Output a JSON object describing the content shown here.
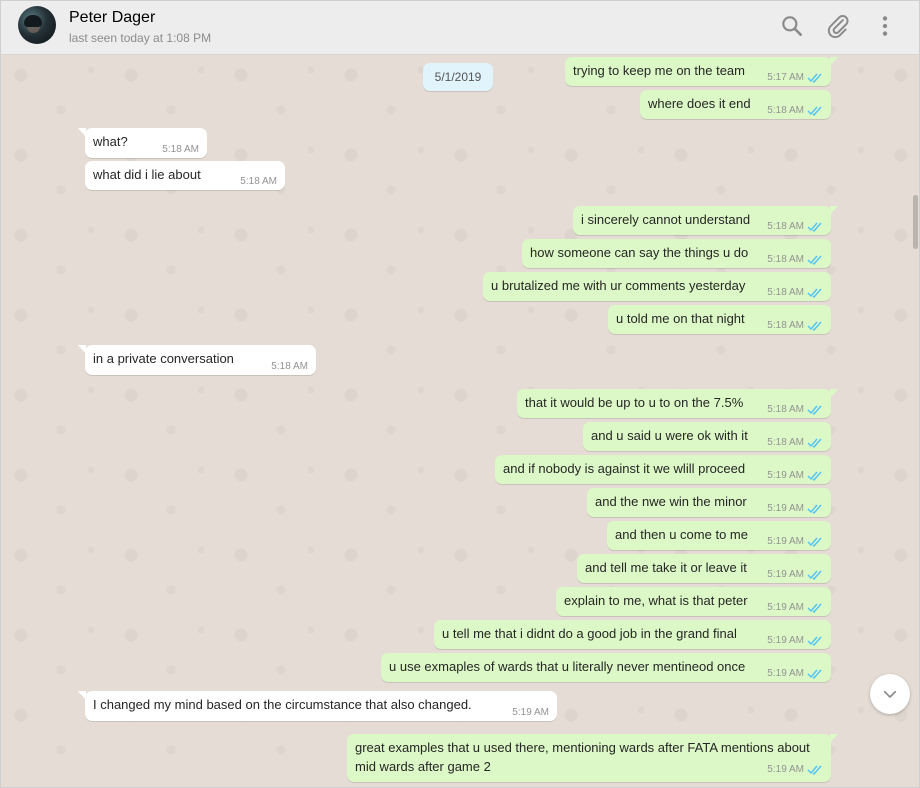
{
  "header": {
    "contact_name": "Peter Dager",
    "last_seen": "last seen today at 1:08 PM",
    "icons": [
      "search-icon",
      "attach-icon",
      "menu-icon"
    ]
  },
  "chat": {
    "date": "5/1/2019",
    "messages": [
      {
        "dir": "out",
        "text": "trying to keep me on the team",
        "time": "5:17 AM"
      },
      {
        "dir": "out",
        "text": "where does it end",
        "time": "5:18 AM"
      },
      {
        "dir": "in",
        "text": "what?",
        "time": "5:18 AM"
      },
      {
        "dir": "in",
        "text": "what did i lie about",
        "time": "5:18 AM"
      },
      {
        "dir": "out",
        "text": "i sincerely cannot understand",
        "time": "5:18 AM"
      },
      {
        "dir": "out",
        "text": "how someone can say the things u do",
        "time": "5:18 AM"
      },
      {
        "dir": "out",
        "text": "u brutalized me with ur comments yesterday",
        "time": "5:18 AM"
      },
      {
        "dir": "out",
        "text": "u told me on that night",
        "time": "5:18 AM"
      },
      {
        "dir": "in",
        "text": "in a private conversation",
        "time": "5:18 AM"
      },
      {
        "dir": "out",
        "text": "that it would be up to u to on the 7.5%",
        "time": "5:18 AM"
      },
      {
        "dir": "out",
        "text": "and u said u were ok with it",
        "time": "5:18 AM"
      },
      {
        "dir": "out",
        "text": "and if nobody is against it we wlill proceed",
        "time": "5:19 AM"
      },
      {
        "dir": "out",
        "text": "and the nwe win the minor",
        "time": "5:19 AM"
      },
      {
        "dir": "out",
        "text": "and then u come to me",
        "time": "5:19 AM"
      },
      {
        "dir": "out",
        "text": "and tell me take it or leave it",
        "time": "5:19 AM"
      },
      {
        "dir": "out",
        "text": "explain to me, what is that peter",
        "time": "5:19 AM"
      },
      {
        "dir": "out",
        "text": "u tell me that i didnt do a good job in the grand final",
        "time": "5:19 AM"
      },
      {
        "dir": "out",
        "text": "u use exmaples of wards that u literally never mentineod once",
        "time": "5:19 AM"
      },
      {
        "dir": "in",
        "text": "I changed my mind based on the circumstance that also changed.",
        "time": "5:19 AM"
      },
      {
        "dir": "out",
        "text": "great examples that u used there, mentioning wards after FATA mentions about mid wards after game 2",
        "time": "5:19 AM"
      }
    ]
  },
  "colors": {
    "outgoing_bubble": "#dcf8c6",
    "incoming_bubble": "#ffffff",
    "chat_background": "#e5ddd5",
    "read_ticks": "#4fc3f7",
    "date_pill": "#e1f3fb"
  }
}
